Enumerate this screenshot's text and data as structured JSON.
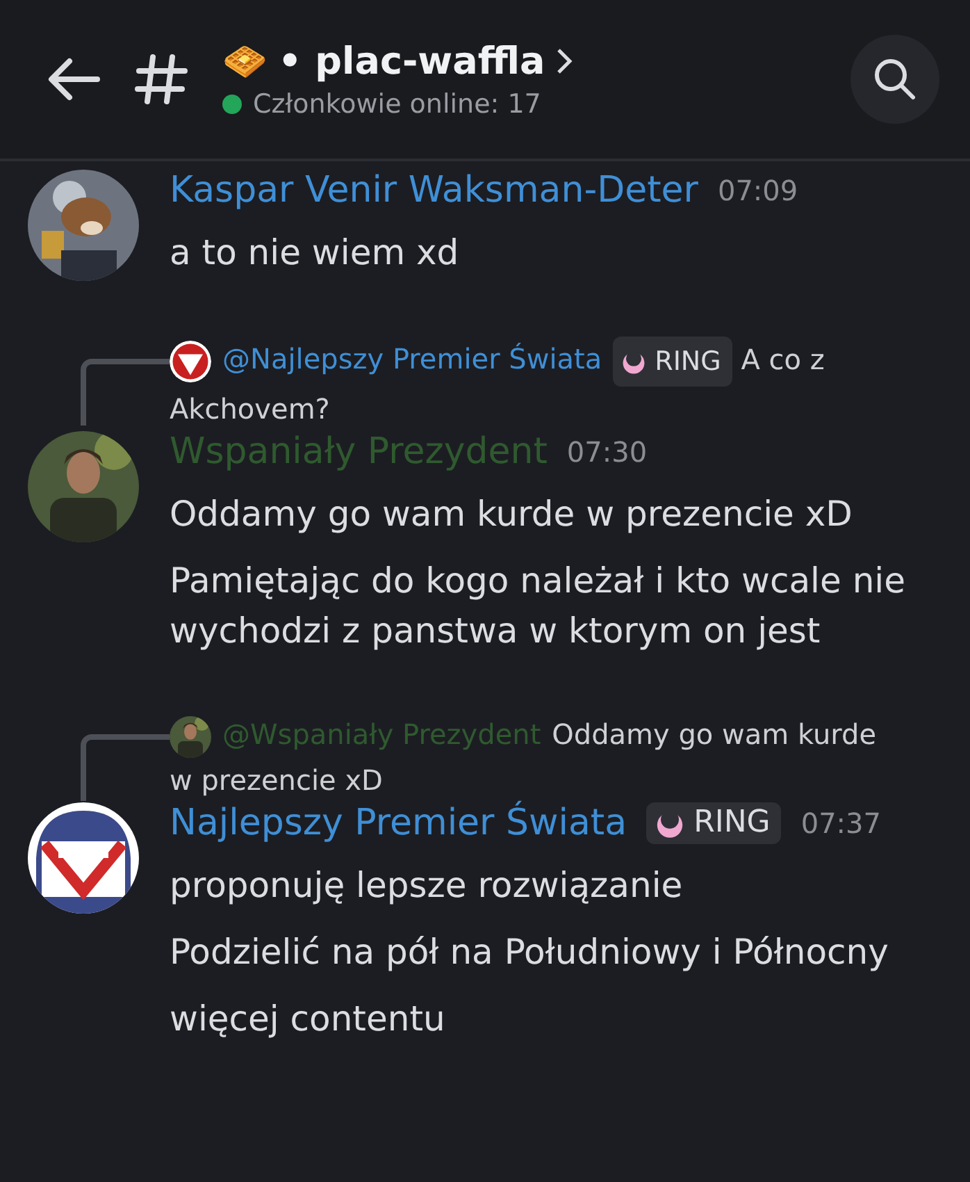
{
  "header": {
    "channel_emoji": "🧇",
    "channel_name": "• plac-waffla",
    "members_online": "Członkowie online: 17"
  },
  "messages": [
    {
      "author": "Kaspar Venir Waksman-Deter",
      "color": "#3f8fd6",
      "time": "07:09",
      "lines": [
        "a to nie wiem xd"
      ]
    },
    {
      "reply": {
        "author": "@Najlepszy Premier Świata",
        "color": "#3f8fd6",
        "badge": "RING",
        "text": "A co z Akchovem?"
      },
      "author": "Wspaniały Prezydent",
      "color": "#2f5a2f",
      "time": "07:30",
      "lines": [
        "Oddamy go wam kurde w prezencie xD",
        "Pamiętając do kogo należał i kto wcale nie wychodzi z panstwa w ktorym on jest"
      ]
    },
    {
      "reply": {
        "author": "@Wspaniały Prezydent",
        "color": "#2f5a2f",
        "text": "Oddamy go wam kurde w prezencie xD"
      },
      "author": "Najlepszy Premier Świata",
      "color": "#3f8fd6",
      "badge": "RING",
      "time": "07:37",
      "lines": [
        "proponuję lepsze rozwiązanie",
        "Podzielić na pół na Południowy i Północny",
        "więcej contentu"
      ]
    }
  ]
}
